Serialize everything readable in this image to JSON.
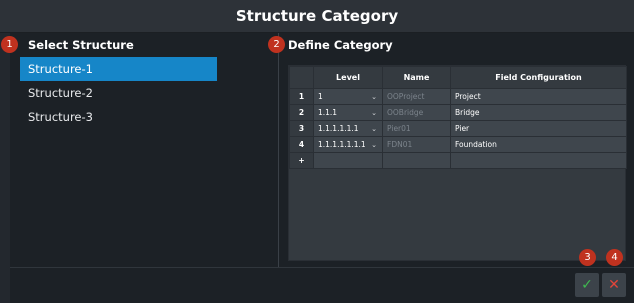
{
  "window": {
    "title": "Structure Category"
  },
  "badges": [
    "1",
    "2",
    "3",
    "4"
  ],
  "left": {
    "heading": "Select Structure",
    "items": [
      "Structure-1",
      "Structure-2",
      "Structure-3"
    ],
    "selected_index": 0
  },
  "right": {
    "heading": "Define Category",
    "columns": [
      "Level",
      "Name",
      "Field Configuration"
    ],
    "rows": [
      {
        "num": "1",
        "level": "1",
        "name": "OOProject",
        "field": "Project"
      },
      {
        "num": "2",
        "level": "1.1.1",
        "name": "OOBridge",
        "field": "Bridge"
      },
      {
        "num": "3",
        "level": "1.1.1.1.1.1",
        "name": "Pier01",
        "field": "Pier"
      },
      {
        "num": "4",
        "level": "1.1.1.1.1.1.1",
        "name": "FDN01",
        "field": "Foundation"
      }
    ],
    "add_row_symbol": "+"
  },
  "actions": {
    "ok_symbol": "✓",
    "cancel_symbol": "✕"
  },
  "colors": {
    "accent": "#1686c8",
    "badge": "#c0321f",
    "ok": "#3fb950",
    "cancel": "#e2453a"
  }
}
